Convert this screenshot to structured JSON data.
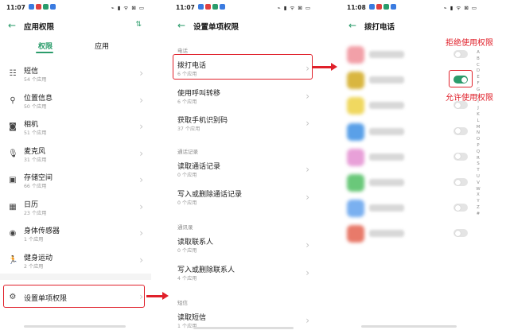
{
  "panel1": {
    "status_time": "11:07",
    "status_right": "⌁ ▮ ᯤ ⊠ ▭",
    "title": "应用权限",
    "tabs": [
      {
        "label": "权限",
        "active": true
      },
      {
        "label": "应用",
        "active": false
      }
    ],
    "items": [
      {
        "icon": "message-icon",
        "glyph": "☷",
        "title": "短信",
        "sub": "54 个应用"
      },
      {
        "icon": "location-pin-icon",
        "glyph": "⚲",
        "title": "位置信息",
        "sub": "50 个应用"
      },
      {
        "icon": "camera-icon",
        "glyph": "◙",
        "title": "相机",
        "sub": "51 个应用"
      },
      {
        "icon": "microphone-icon",
        "glyph": "🎙",
        "title": "麦克风",
        "sub": "31 个应用"
      },
      {
        "icon": "storage-icon",
        "glyph": "▣",
        "title": "存储空间",
        "sub": "66 个应用"
      },
      {
        "icon": "calendar-icon",
        "glyph": "▦",
        "title": "日历",
        "sub": "23 个应用"
      },
      {
        "icon": "body-sensor-icon",
        "glyph": "◉",
        "title": "身体传感器",
        "sub": "1 个应用"
      },
      {
        "icon": "fitness-run-icon",
        "glyph": "🏃",
        "title": "健身运动",
        "sub": "2 个应用"
      }
    ],
    "single_setting": "设置单项权限"
  },
  "panel2": {
    "status_time": "11:07",
    "status_right": "⌁ ▮ ᯤ ⊠ ▭",
    "title": "设置单项权限",
    "sections": [
      {
        "label": "电话",
        "items": [
          {
            "title": "拨打电话",
            "sub": "6 个应用"
          },
          {
            "title": "使用呼叫转移",
            "sub": "6 个应用"
          },
          {
            "title": "获取手机识别码",
            "sub": "37 个应用"
          }
        ]
      },
      {
        "label": "通话记录",
        "items": [
          {
            "title": "读取通话记录",
            "sub": "0 个应用"
          },
          {
            "title": "写入或删除通话记录",
            "sub": "0 个应用"
          }
        ]
      },
      {
        "label": "通讯录",
        "items": [
          {
            "title": "读取联系人",
            "sub": "0 个应用"
          },
          {
            "title": "写入或删除联系人",
            "sub": "4 个应用"
          }
        ]
      },
      {
        "label": "短信",
        "items": [
          {
            "title": "读取短信",
            "sub": "1 个应用"
          }
        ]
      }
    ]
  },
  "panel3": {
    "status_time": "11:08",
    "status_right": "⌁ ▮ ᯤ ⊠ ▭",
    "title": "拨打电话",
    "apps": [
      {
        "icon_color": "#f2a0a8",
        "toggle_on": false
      },
      {
        "icon_color": "#d9b640",
        "toggle_on": true
      },
      {
        "icon_color": "#f0d860",
        "toggle_on": false
      },
      {
        "icon_color": "#5aa0e8",
        "toggle_on": false
      },
      {
        "icon_color": "#e8a0d8",
        "toggle_on": false
      },
      {
        "icon_color": "#6ac87a",
        "toggle_on": false
      },
      {
        "icon_color": "#7ab0f0",
        "toggle_on": false
      },
      {
        "icon_color": "#e87a6a",
        "toggle_on": false
      }
    ],
    "alphabet": [
      "A",
      "B",
      "C",
      "D",
      "E",
      "F",
      "G",
      "H",
      "I",
      "J",
      "K",
      "L",
      "M",
      "N",
      "O",
      "P",
      "Q",
      "R",
      "S",
      "T",
      "U",
      "V",
      "W",
      "X",
      "Y",
      "Z",
      "#"
    ]
  },
  "annotations": {
    "deny": "拒绝使用权限",
    "allow": "允许使用权限"
  },
  "colors": {
    "accent": "#2b9c6b",
    "highlight": "#e0202a"
  }
}
